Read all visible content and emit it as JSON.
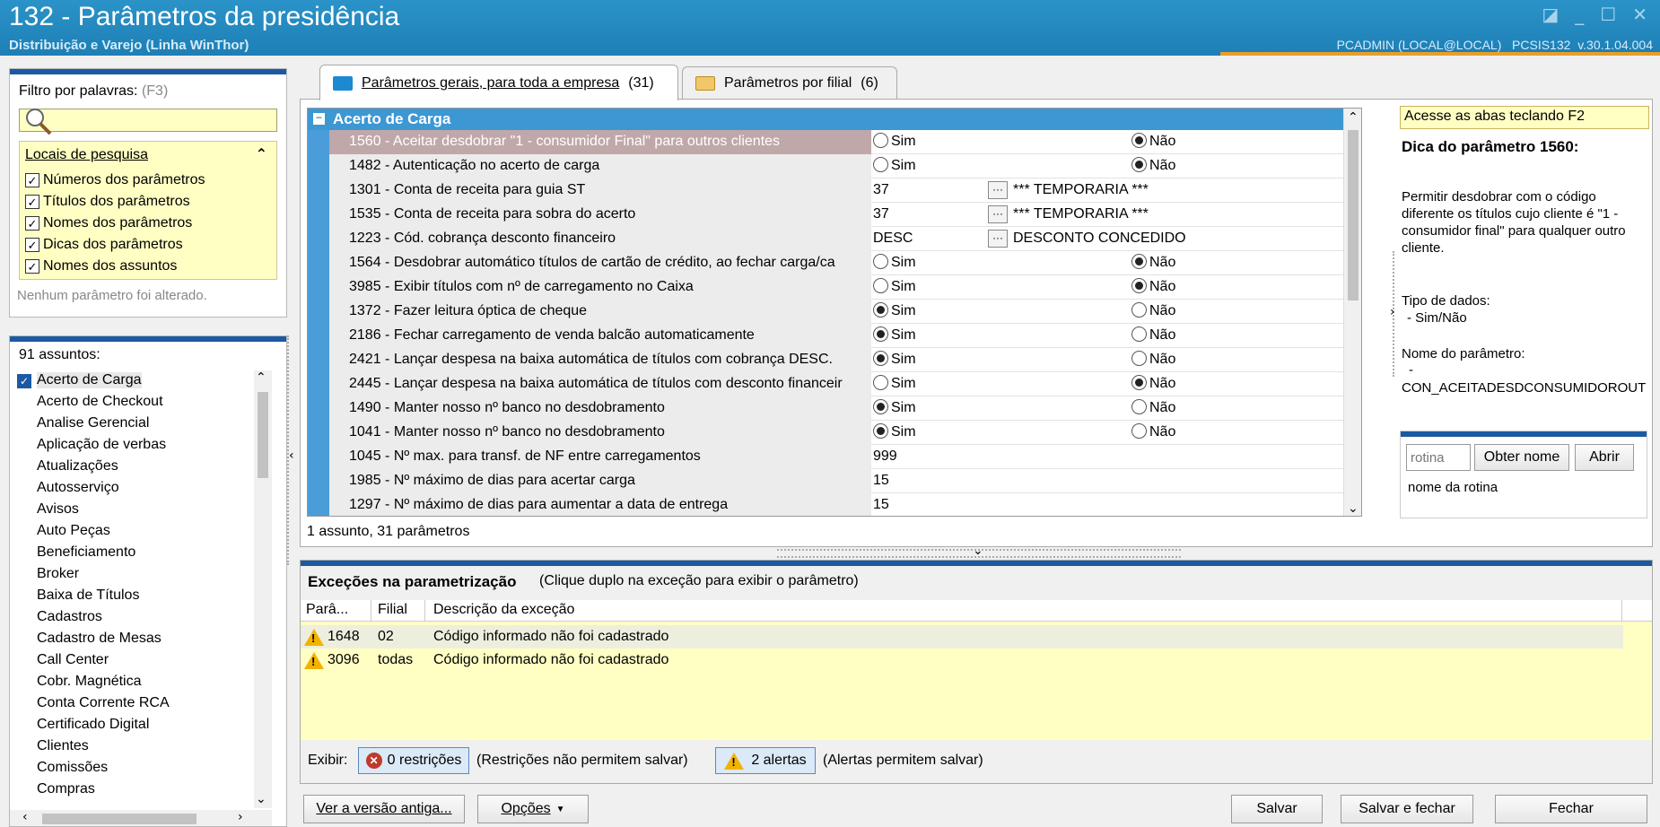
{
  "window": {
    "title": "132 - Parâmetros da presidência",
    "subtitle": "Distribuição e Varejo (Linha WinThor)",
    "user_info": "PCADMIN (LOCAL@LOCAL)   PCSIS132  v.30.1.04.004"
  },
  "filter": {
    "label": "Filtro por palavras:",
    "shortcut": "(F3)",
    "search_header": "Locais de pesquisa",
    "options": [
      {
        "label": "Números dos parâmetros",
        "checked": true
      },
      {
        "label": "Títulos dos parâmetros",
        "checked": true
      },
      {
        "label": "Nomes dos parâmetros",
        "checked": true
      },
      {
        "label": "Dicas dos parâmetros",
        "checked": true
      },
      {
        "label": "Nomes dos assuntos",
        "checked": true
      }
    ],
    "status": "Nenhum parâmetro foi alterado."
  },
  "subjects": {
    "count_label": "91 assuntos:",
    "items": [
      "Acerto de Carga",
      "Acerto de Checkout",
      "Analise Gerencial",
      "Aplicação de verbas",
      "Atualizações",
      "Autosserviço",
      "Avisos",
      "Auto Peças",
      "Beneficiamento",
      "Broker",
      "Baixa de Títulos",
      "Cadastros",
      "Cadastro de Mesas",
      "Call Center",
      "Cobr. Magnética",
      "Conta Corrente RCA",
      "Certificado Digital",
      "Clientes",
      "Comissões",
      "Compras"
    ]
  },
  "tabs": [
    {
      "label": "Parâmetros gerais, para toda a empresa",
      "count": "(31)",
      "active": true
    },
    {
      "label": "Parâmetros por filial",
      "count": "(6)",
      "active": false
    }
  ],
  "grid": {
    "group": "Acerto de Carga",
    "yes_label": "Sim",
    "no_label": "Não",
    "rows": [
      {
        "name": "1560 - Aceitar desdobrar \"1 - consumidor Final\" para outros clientes",
        "type": "bool",
        "value": "Não",
        "selected": true
      },
      {
        "name": "1482 - Autenticação no acerto de carga",
        "type": "bool",
        "value": "Não"
      },
      {
        "name": "1301 - Conta de receita para guia ST",
        "type": "lookup",
        "value": "37",
        "desc": "*** TEMPORARIA ***"
      },
      {
        "name": "1535 - Conta de receita para sobra do acerto",
        "type": "lookup",
        "value": "37",
        "desc": "*** TEMPORARIA ***"
      },
      {
        "name": "1223 - Cód. cobrança desconto financeiro",
        "type": "lookup",
        "value": "DESC",
        "desc": "DESCONTO CONCEDIDO"
      },
      {
        "name": "1564 - Desdobrar automático títulos de cartão de crédito, ao fechar carga/ca",
        "type": "bool",
        "value": "Não"
      },
      {
        "name": "3985 - Exibir títulos com nº de carregamento no Caixa",
        "type": "bool",
        "value": "Não"
      },
      {
        "name": "1372 - Fazer leitura óptica de cheque",
        "type": "bool",
        "value": "Sim"
      },
      {
        "name": "2186 - Fechar carregamento de venda balcão automaticamente",
        "type": "bool",
        "value": "Sim"
      },
      {
        "name": "2421 - Lançar despesa na baixa automática de títulos com cobrança DESC.",
        "type": "bool",
        "value": "Sim"
      },
      {
        "name": "2445 - Lançar despesa na baixa automática de títulos com desconto financeir",
        "type": "bool",
        "value": "Não"
      },
      {
        "name": "1490 - Manter nosso nº banco no desdobramento",
        "type": "bool",
        "value": "Sim"
      },
      {
        "name": "1041 - Manter nosso nº banco no desdobramento",
        "type": "bool",
        "value": "Sim"
      },
      {
        "name": "1045 - Nº max. para transf. de NF entre carregamentos",
        "type": "text",
        "value": "999"
      },
      {
        "name": "1985 - Nº máximo de dias para acertar carga",
        "type": "text",
        "value": "15"
      },
      {
        "name": "1297 - Nº máximo de dias para aumentar a data de entrega",
        "type": "text",
        "value": "15"
      }
    ],
    "footer": "1 assunto, 31 parâmetros"
  },
  "tip": {
    "hint": "Acesse as abas teclando F2",
    "title": "Dica do parâmetro 1560:",
    "text": "Permitir desdobrar com o código diferente os títulos cujo cliente é \"1 - consumidor final\" para qualquer outro cliente.",
    "type_label": "Tipo de dados:",
    "type_value": "- Sim/Não",
    "param_label": "Nome do parâmetro:",
    "param_dash": "-",
    "param_value": "CON_ACEITADESDCONSUMIDOROUT",
    "rotina_placeholder": "rotina",
    "get_name_btn": "Obter nome",
    "open_btn": "Abrir",
    "rotina_name": "nome da rotina"
  },
  "exceptions": {
    "title": "Exceções na parametrização",
    "subtitle": "(Clique duplo na exceção para exibir o parâmetro)",
    "columns": [
      "Parâ...",
      "Filial",
      "Descrição da exceção"
    ],
    "rows": [
      {
        "param": "1648",
        "filial": "02",
        "desc": "Código informado não foi cadastrado"
      },
      {
        "param": "3096",
        "filial": "todas",
        "desc": "Código informado não foi cadastrado"
      }
    ],
    "show_label": "Exibir:",
    "restrictions_btn": "0 restrições",
    "restrictions_note": "(Restrições não permitem salvar)",
    "alerts_btn": "2 alertas",
    "alerts_note": "(Alertas permitem salvar)"
  },
  "footer_buttons": {
    "old_version": "Ver a versão antiga...",
    "options": "Opções",
    "save": "Salvar",
    "save_close": "Salvar e fechar",
    "close": "Fechar"
  },
  "colors": {
    "titlebar": "#1d7fb5",
    "accent_blue": "#1b5aa3",
    "highlight_yellow": "#ffffc4",
    "warning": "#f2b300"
  }
}
